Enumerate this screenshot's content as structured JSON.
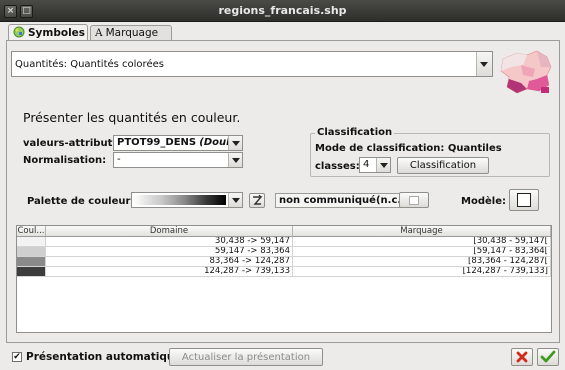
{
  "window": {
    "title": "regions_francais.shp",
    "close_glyph": "×",
    "restore_glyph": "□"
  },
  "tabs": [
    {
      "label": "Symboles",
      "icon": "symbols-icon",
      "active": true
    },
    {
      "label": "Marquage",
      "icon": "text-label-icon",
      "glyph": "A",
      "active": false
    }
  ],
  "type_combo": {
    "value": "Quantités: Quantités colorées"
  },
  "heading": "Présenter les quantités en couleur.",
  "field": {
    "label": "valeurs-attribut:",
    "value": "PTOT99_DENS",
    "value_type": "(Double)"
  },
  "normalisation": {
    "label": "Normalisation:",
    "value": "-"
  },
  "classification": {
    "legend": "Classification",
    "mode_text": "Mode de classification: Quantiles",
    "classes_label": "classes:",
    "classes_value": "4",
    "button_label": "Classification"
  },
  "palette": {
    "label": "Palette de couleur:",
    "swap_icon": "swap-icon"
  },
  "nc": {
    "label": "non communiqué(n.c.):"
  },
  "modele": {
    "label": "Modèle:"
  },
  "table": {
    "headers": [
      "Coul...",
      "Domaine",
      "Marquage"
    ],
    "rows": [
      {
        "color": "#f3f3f3",
        "domaine": "30,438 -> 59,147",
        "marquage": "[30,438 - 59,147["
      },
      {
        "color": "#cfcfcf",
        "domaine": "59,147 -> 83,364",
        "marquage": "[59,147 - 83,364["
      },
      {
        "color": "#8a8a8a",
        "domaine": "83,364 -> 124,287",
        "marquage": "[83,364 - 124,287["
      },
      {
        "color": "#3d3d3d",
        "domaine": "124,287 -> 739,133",
        "marquage": "[124,287 - 739,133]"
      }
    ]
  },
  "bottom": {
    "auto_label": "Présentation automatique",
    "auto_checked": "✔",
    "update_label": "Actualiser la présentation",
    "cancel_icon": "cancel-icon",
    "ok_icon": "ok-icon"
  },
  "colors": {
    "titlebar": "#3a3a37",
    "cancel": "#d12a1e",
    "ok": "#3f9a1f"
  }
}
